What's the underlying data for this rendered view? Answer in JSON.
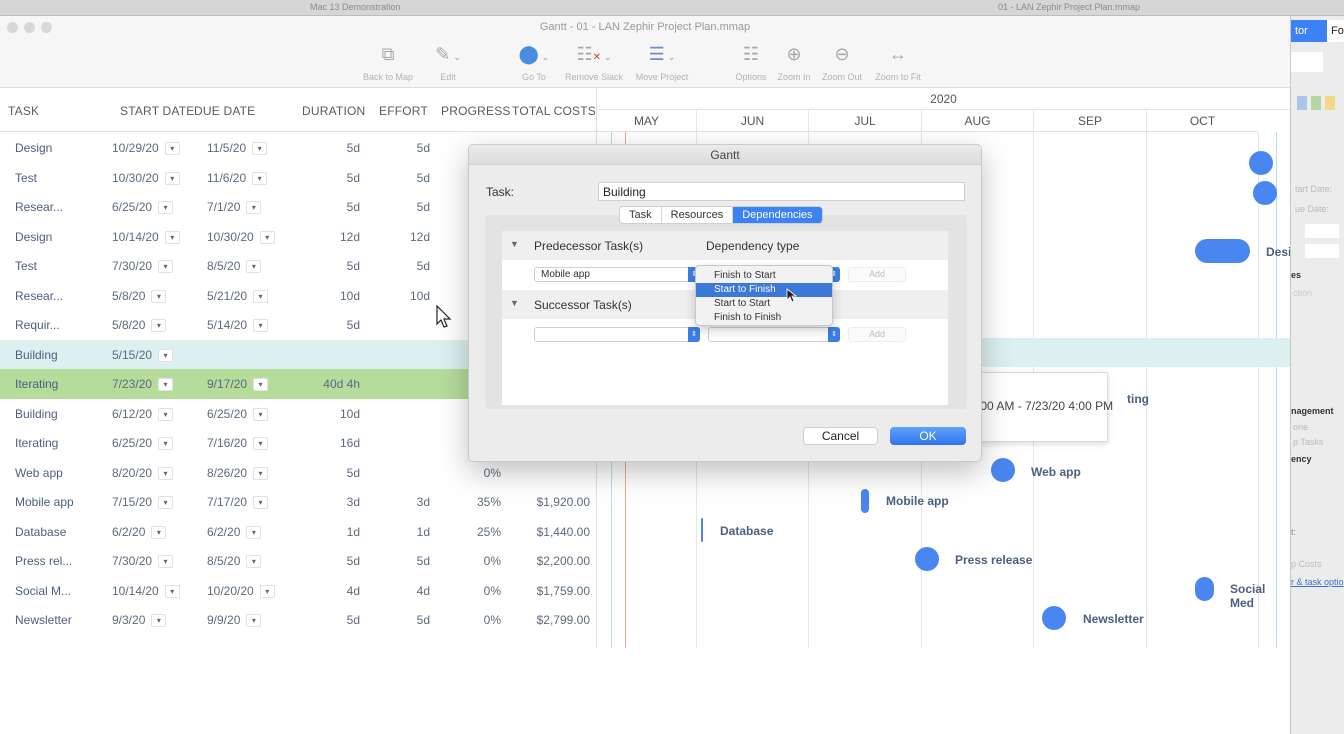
{
  "screen": {
    "top_left_title": "Mac 13 Demonstration",
    "top_right_title": "01 - LAN Zephir Project Plan.mmap"
  },
  "window": {
    "title": "Gantt - 01 - LAN Zephir Project Plan.mmap",
    "toolbar": [
      {
        "label": "Back to Map",
        "icon": "map-icon"
      },
      {
        "label": "Edit",
        "icon": "pencil-icon"
      },
      {
        "label": "Go To",
        "icon": "location-pin-icon"
      },
      {
        "label": "Remove Slack",
        "icon": "remove-slack-icon"
      },
      {
        "label": "Move Project",
        "icon": "move-project-icon"
      },
      {
        "label": "Options",
        "icon": "options-icon"
      },
      {
        "label": "Zoom In",
        "icon": "zoom-in-icon"
      },
      {
        "label": "Zoom Out",
        "icon": "zoom-out-icon"
      },
      {
        "label": "Zoom to Fit",
        "icon": "zoom-to-fit-icon"
      }
    ]
  },
  "grid": {
    "columns": [
      "TASK",
      "START DATE",
      "DUE DATE",
      "DURATION",
      "EFFORT",
      "PROGRESS",
      "TOTAL COSTS"
    ],
    "rows": [
      {
        "name": "Design",
        "start": "10/29/20",
        "due": "11/5/20",
        "duration": "5d",
        "effort": "5d",
        "progress": "",
        "cost": ""
      },
      {
        "name": "Test",
        "start": "10/30/20",
        "due": "11/6/20",
        "duration": "5d",
        "effort": "5d",
        "progress": "",
        "cost": ""
      },
      {
        "name": "Resear...",
        "start": "6/25/20",
        "due": "7/1/20",
        "duration": "5d",
        "effort": "5d",
        "progress": "",
        "cost": ""
      },
      {
        "name": "Design",
        "start": "10/14/20",
        "due": "10/30/20",
        "duration": "12d",
        "effort": "12d",
        "progress": "",
        "cost": ""
      },
      {
        "name": "Test",
        "start": "7/30/20",
        "due": "8/5/20",
        "duration": "5d",
        "effort": "5d",
        "progress": "",
        "cost": ""
      },
      {
        "name": "Resear...",
        "start": "5/8/20",
        "due": "5/21/20",
        "duration": "10d",
        "effort": "10d",
        "progress": "",
        "cost": ""
      },
      {
        "name": "Requir...",
        "start": "5/8/20",
        "due": "5/14/20",
        "duration": "5d",
        "effort": "",
        "progress": "",
        "cost": ""
      },
      {
        "name": "Building",
        "start": "5/15/20",
        "due": "",
        "duration": "",
        "effort": "",
        "progress": "",
        "cost": "",
        "state": "selected"
      },
      {
        "name": "Iterating",
        "start": "7/23/20",
        "due": "9/17/20",
        "duration": "40d 4h",
        "effort": "",
        "progress": "",
        "cost": "",
        "state": "highlight"
      },
      {
        "name": "Building",
        "start": "6/12/20",
        "due": "6/25/20",
        "duration": "10d",
        "effort": "",
        "progress": "",
        "cost": ""
      },
      {
        "name": "Iterating",
        "start": "6/25/20",
        "due": "7/16/20",
        "duration": "16d",
        "effort": "",
        "progress": "",
        "cost": ""
      },
      {
        "name": "Web app",
        "start": "8/20/20",
        "due": "8/26/20",
        "duration": "5d",
        "effort": "",
        "progress": "0%",
        "cost": ""
      },
      {
        "name": "Mobile app",
        "start": "7/15/20",
        "due": "7/17/20",
        "duration": "3d",
        "effort": "3d",
        "progress": "35%",
        "cost": "$1,920.00"
      },
      {
        "name": "Database",
        "start": "6/2/20",
        "due": "6/2/20",
        "duration": "1d",
        "effort": "1d",
        "progress": "25%",
        "cost": "$1,440.00"
      },
      {
        "name": "Press rel...",
        "start": "7/30/20",
        "due": "8/5/20",
        "duration": "5d",
        "effort": "5d",
        "progress": "0%",
        "cost": "$2,200.00"
      },
      {
        "name": "Social M...",
        "start": "10/14/20",
        "due": "10/20/20",
        "duration": "4d",
        "effort": "4d",
        "progress": "0%",
        "cost": "$1,759.00"
      },
      {
        "name": "Newsletter",
        "start": "9/3/20",
        "due": "9/9/20",
        "duration": "5d",
        "effort": "5d",
        "progress": "0%",
        "cost": "$2,799.00"
      }
    ]
  },
  "gantt": {
    "year": "2020",
    "months": [
      "MAY",
      "JUN",
      "JUL",
      "AUG",
      "SEP",
      "OCT"
    ],
    "bar_labels": {
      "design": "Desi",
      "iterating": "ting",
      "web_app": "Web app",
      "mobile_app": "Mobile app",
      "database": "Database",
      "press_release": "Press release",
      "social_media": "Social Med",
      "newsletter": "Newsletter"
    },
    "tooltip": ":00 AM - 7/23/20 4:00 PM",
    "bar_color": "#4a86f0"
  },
  "side_panel": {
    "tab_active": "tor",
    "tab_other": "For",
    "labels": [
      "tart Date:",
      "ue Date:",
      "es",
      "ction",
      "nagement",
      "one",
      "p Tasks",
      "ency",
      "t:",
      "p Costs",
      "r & task optio"
    ]
  },
  "dialog": {
    "title": "Gantt",
    "task_label": "Task:",
    "task_value": "Building",
    "tabs": [
      "Task",
      "Resources",
      "Dependencies"
    ],
    "active_tab": "Dependencies",
    "predecessor_header": "Predecessor Task(s)",
    "dependency_type_header": "Dependency type",
    "predecessor_value": "Mobile app",
    "successor_header": "Successor Task(s)",
    "add_label": "Add",
    "dependency_options": [
      "Finish to Start",
      "Start to Finish",
      "Start to Start",
      "Finish to Finish"
    ],
    "highlighted_option": "Start to Finish",
    "cancel_label": "Cancel",
    "ok_label": "OK"
  }
}
